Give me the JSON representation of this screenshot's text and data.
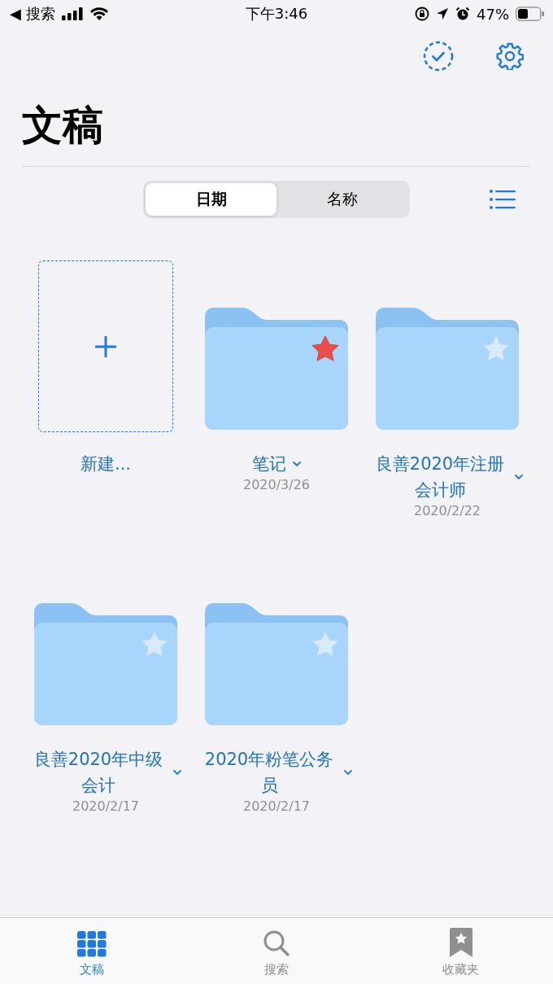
{
  "status_bar": {
    "back_app": "◀ 搜索",
    "time": "下午3:46",
    "battery": "47%"
  },
  "title": "文稿",
  "sort_segments": [
    {
      "label": "日期",
      "selected": true
    },
    {
      "label": "名称",
      "selected": false
    }
  ],
  "new_item": {
    "label": "新建..."
  },
  "folders": [
    {
      "name": "笔记",
      "date": "2020/3/26",
      "favorite": true
    },
    {
      "name": "良善2020年注册会计师",
      "date": "2020/2/22",
      "favorite": false
    },
    {
      "name": "良善2020年中级会计",
      "date": "2020/2/17",
      "favorite": false
    },
    {
      "name": "2020年粉笔公务员",
      "date": "2020/2/17",
      "favorite": false
    }
  ],
  "tabs": [
    {
      "label": "文稿",
      "kind": "grid",
      "selected": true
    },
    {
      "label": "搜索",
      "kind": "search",
      "selected": false
    },
    {
      "label": "收藏夹",
      "kind": "bookmark",
      "selected": false
    }
  ]
}
